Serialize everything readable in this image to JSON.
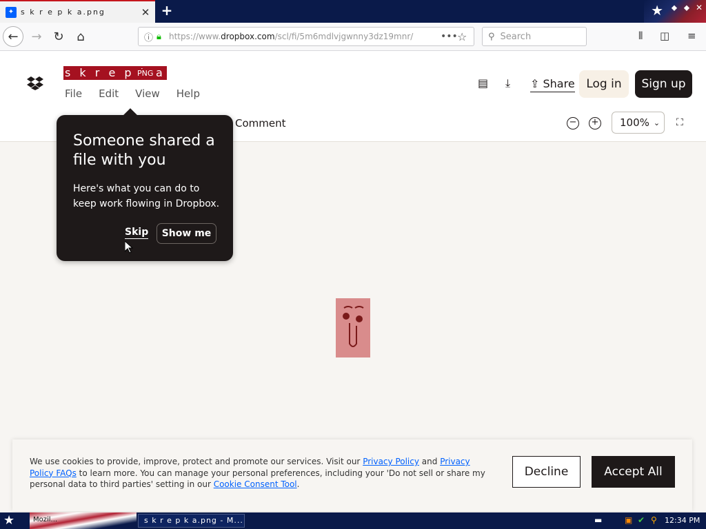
{
  "browser": {
    "tab_title": "s k r e p k a.png",
    "url_prefix": "https://www.",
    "url_domain": "dropbox.com",
    "url_rest": "/scl/fi/5m6mdlvjgwnny3dz19mnr/",
    "search_placeholder": "Search"
  },
  "app": {
    "file_name": "s k r e p k a",
    "file_ext": "PNG",
    "menu": [
      "File",
      "Edit",
      "View",
      "Help"
    ],
    "share_label": "Share",
    "login_label": "Log in",
    "signup_label": "Sign up",
    "comment_label": "Comment",
    "zoom_value": "100%"
  },
  "popup": {
    "title": "Someone shared a file with you",
    "body": "Here's what you can do to keep work flowing in Dropbox.",
    "skip_label": "Skip",
    "show_me_label": "Show me"
  },
  "cookie": {
    "text_1": "We use cookies to provide, improve, protect and promote our services. Visit our ",
    "link_privacy": "Privacy Policy",
    "text_2": " and ",
    "link_faqs": "Privacy Policy FAQs",
    "text_3": " to learn more. You can manage your personal preferences, including your 'Do not sell or share my personal data to third parties' setting in our ",
    "link_consent": "Cookie Consent Tool",
    "text_4": ".",
    "decline_label": "Decline",
    "accept_label": "Accept All"
  },
  "taskbar": {
    "mozilla_label": "Mozil...",
    "task_title": "s k r e p k a.png - M...",
    "clock": "12:34 PM"
  },
  "colors": {
    "accent": "#0061fe",
    "dark": "#1e1919",
    "highlight": "#a51120"
  }
}
